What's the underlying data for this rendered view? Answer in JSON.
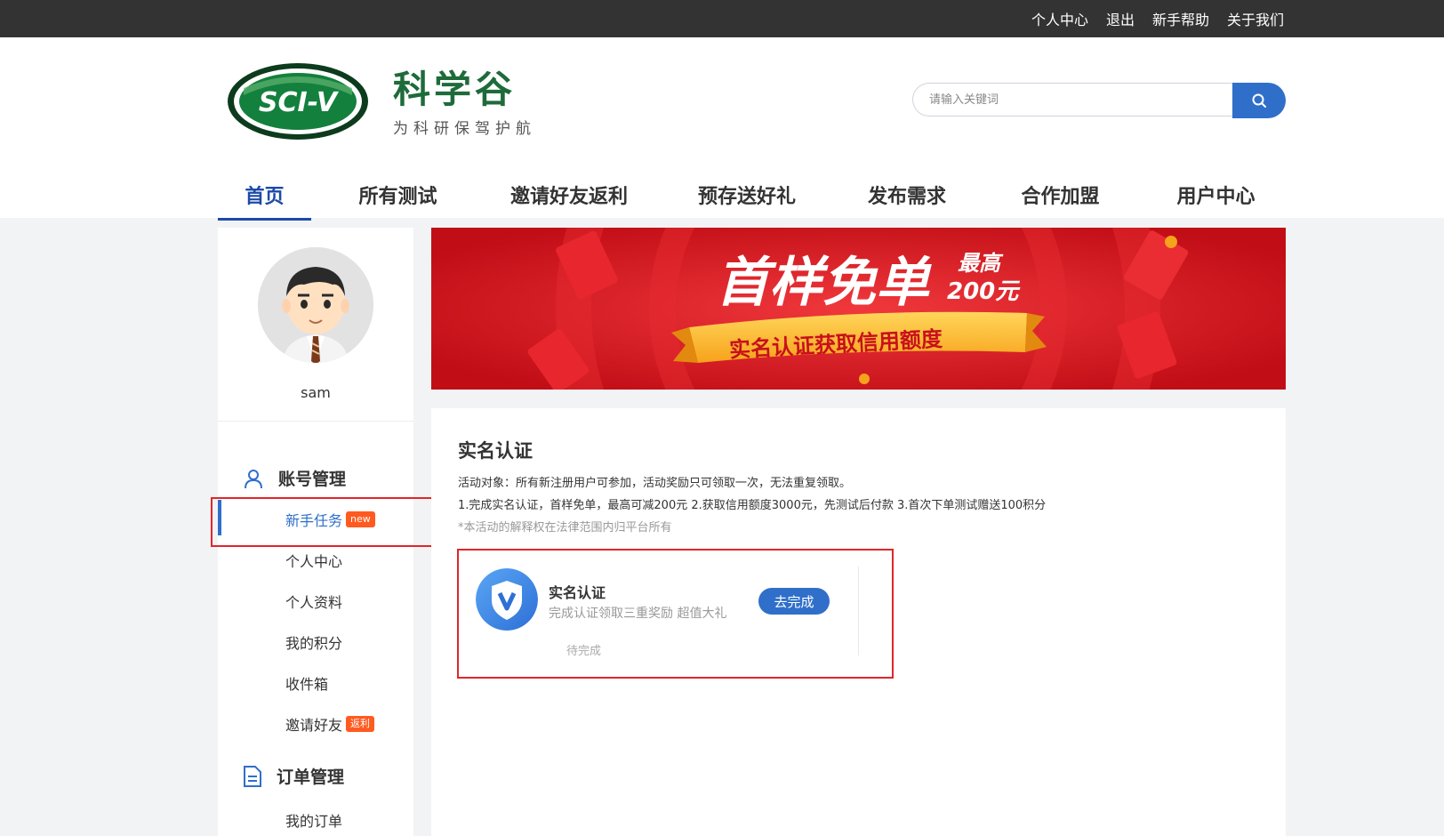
{
  "topbar": {
    "links": [
      "个人中心",
      "退出",
      "新手帮助",
      "关于我们"
    ]
  },
  "logo": {
    "oval_text": "SCI-V",
    "name": "科学谷",
    "slogan": "为科研保驾护航"
  },
  "search": {
    "placeholder": "请输入关键词"
  },
  "nav": {
    "items": [
      "首页",
      "所有测试",
      "邀请好友返利",
      "预存送好礼",
      "发布需求",
      "合作加盟",
      "用户中心"
    ],
    "active": "首页"
  },
  "sidebar": {
    "username": "sam",
    "account_group": "账号管理",
    "account_items": [
      "新手任务",
      "个人中心",
      "个人资料",
      "我的积分",
      "收件箱",
      "邀请好友"
    ],
    "badge_new": "new",
    "badge_rebate": "返利",
    "order_group": "订单管理",
    "order_items": [
      "我的订单"
    ]
  },
  "banner": {
    "headline": "首样免单",
    "max_label": "最高",
    "max_amount": "200元",
    "ribbon": "实名认证获取信用额度"
  },
  "main": {
    "title": "实名认证",
    "line1": "活动对象：所有新注册用户可参加，活动奖励只可领取一次，无法重复领取。",
    "line2": "1.完成实名认证，首样免单，最高可减200元 2.获取信用额度3000元，先测试后付款 3.首次下单测试赠送100积分",
    "line3": "*本活动的解释权在法律范围内归平台所有",
    "task": {
      "title": "实名认证",
      "subtitle": "完成认证领取三重奖励 超值大礼",
      "button": "去完成",
      "status": "待完成"
    }
  },
  "colors": {
    "primary": "#2f6fca",
    "highlight": "#e0262a",
    "banner_red": "#d9141c",
    "brand_green": "#1e6b3a"
  }
}
